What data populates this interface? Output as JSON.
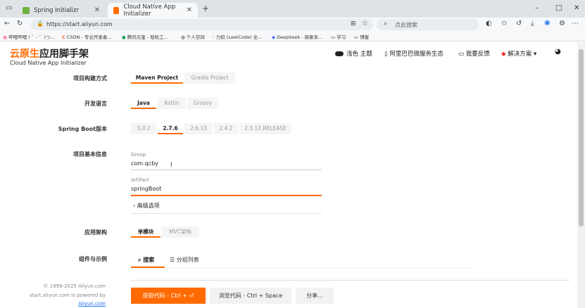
{
  "browser": {
    "tabs": [
      {
        "title": "Spring Initializr"
      },
      {
        "title": "Cloud Native App Initializer"
      }
    ],
    "new_tab": "+",
    "window_controls": {
      "minimize": "–",
      "maximize": "□",
      "close": "✕"
    },
    "url": "https://start.aliyun.com",
    "search_placeholder": "点此搜索",
    "bookmarks": [
      "哔哩哔哩 ( ゜- ゜)つ...",
      "CSDN - 专业开发者...",
      "腾讯元宝 - 轻松工...",
      "个人空间",
      "力扣 (LeetCode) 全...",
      "DeepSeek - 探索未...",
      "学习",
      "博客"
    ]
  },
  "brand": {
    "title_orange": "云原生",
    "title_rest": "应用脚手架",
    "subtitle": "Cloud Native App Initializer"
  },
  "nav": {
    "theme": "浅色 主题",
    "ecosystem": "阿里巴巴微服务生态",
    "feedback": "我要反馈",
    "solutions": "解决方案"
  },
  "form": {
    "build": {
      "label": "项目构建方式",
      "options": [
        "Maven Project",
        "Gradle Project"
      ],
      "selected": "Maven Project"
    },
    "language": {
      "label": "开发语言",
      "options": [
        "Java",
        "Kotlin",
        "Groovy"
      ],
      "selected": "Java"
    },
    "boot": {
      "label": "Spring Boot版本",
      "options": [
        "3.0.2",
        "2.7.6",
        "2.6.13",
        "2.4.2",
        "2.3.12.RELEASE"
      ],
      "selected": "2.7.6"
    },
    "meta": {
      "label": "项目基本信息",
      "group_label": "Group",
      "group_value": "com.qcby",
      "artifact_label": "Artifact",
      "artifact_value": "springBoot",
      "advanced": "高级选项"
    },
    "arch": {
      "label": "应用架构",
      "options": [
        "单模块",
        "MVC架构"
      ],
      "selected": "单模块"
    },
    "components": {
      "label": "组件与示例",
      "tab_search": "搜索",
      "tab_list": "分组列表"
    }
  },
  "footer": {
    "copyright": "© 1999-2025 Aliyun.com",
    "powered": "start.aliyun.com is powered by",
    "link": "Aliyun.com"
  },
  "actions": {
    "get_code": "获取代码 - Ctrl + ⏎",
    "browse_code": "浏览代码 - Ctrl + Space",
    "share": "分享..."
  },
  "colors": {
    "accent": "#ff6a00"
  }
}
